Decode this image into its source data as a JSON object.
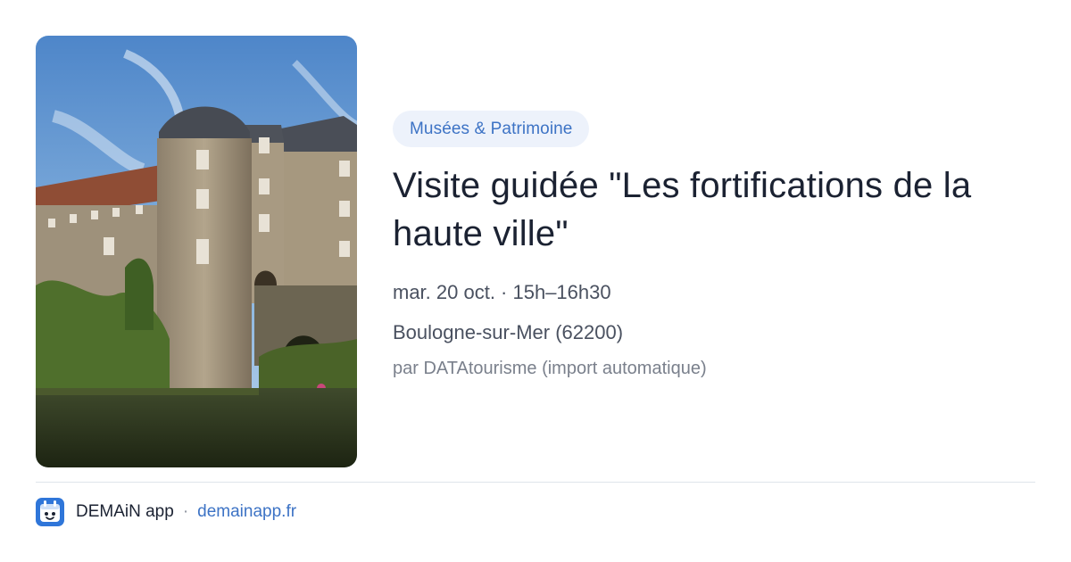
{
  "event": {
    "category": "Musées & Patrimoine",
    "title": "Visite guidée \"Les fortifications de la haute ville\"",
    "datetime": "mar. 20 oct. · 15h–16h30",
    "location": "Boulogne-sur-Mer (62200)",
    "source": "par DATAtourisme (import automatique)"
  },
  "footer": {
    "app_name": "DEMAiN app",
    "separator": "·",
    "url": "demainapp.fr"
  },
  "colors": {
    "accent": "#3d73c5",
    "tag_background": "#edf2fb",
    "title": "#1b2232",
    "muted": "#7a808c"
  },
  "icons": {
    "app_logo": "demain-logo-icon"
  }
}
